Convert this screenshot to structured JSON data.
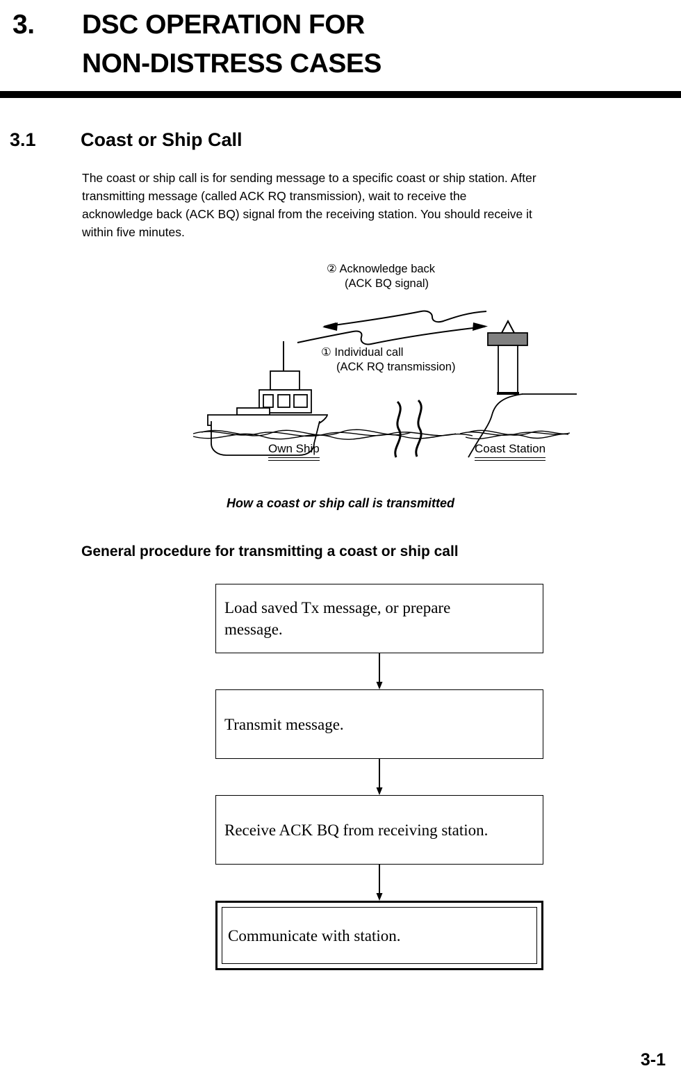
{
  "chapter": {
    "number": "3.",
    "title_line1": "DSC OPERATION FOR",
    "title_line2": "NON-DISTRESS CASES"
  },
  "section": {
    "number": "3.1",
    "title": "Coast or Ship Call",
    "paragraph_lines": [
      "The coast or ship call is for sending message to a specific coast or ship station. After",
      "transmitting message (called ACK RQ transmission), wait to receive the",
      "acknowledge back (ACK BQ) signal from the receiving station. You should receive it",
      "within five minutes."
    ]
  },
  "illustration": {
    "ack_label_line1": "② Acknowledge back",
    "ack_label_line2": "(ACK BQ signal)",
    "individual_label_line1": "① Individual call",
    "individual_label_line2": "(ACK RQ transmission)",
    "own_ship_label": "Own Ship",
    "coast_station_label": "Coast Station",
    "caption": "How a coast or ship call is transmitted",
    "antenna_platform_color": "#808080"
  },
  "procedure": {
    "heading": "General procedure for transmitting a coast or ship call",
    "steps": [
      {
        "line1": "Load saved Tx message, or prepare",
        "line2": "message.",
        "terminal": false
      },
      {
        "line1": "Transmit message.",
        "line2": "",
        "terminal": false
      },
      {
        "line1": "Receive ACK BQ from receiving station.",
        "line2": "",
        "terminal": false
      },
      {
        "line1": "Communicate with station.",
        "line2": "",
        "terminal": true
      }
    ]
  },
  "footer": {
    "page_number": "3-1"
  }
}
